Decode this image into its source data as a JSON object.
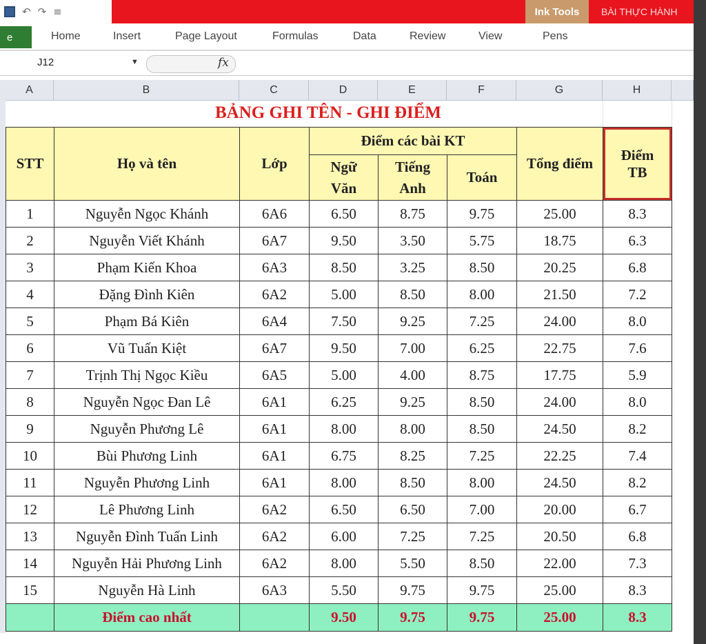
{
  "titlebar": {
    "ink_tools": "Ink Tools",
    "doc_title": "BÀI THỰC HÀNH"
  },
  "ribbon": {
    "file_tab": "e",
    "tabs": [
      "Home",
      "Insert",
      "Page Layout",
      "Formulas",
      "Data",
      "Review",
      "View",
      "Pens"
    ]
  },
  "formula_bar": {
    "name_box": "J12",
    "fx_label": "fx",
    "formula": ""
  },
  "columns": [
    "A",
    "B",
    "C",
    "D",
    "E",
    "F",
    "G",
    "H"
  ],
  "sheet": {
    "title": "BẢNG GHI TÊN - GHI ĐIỂM",
    "headers": {
      "stt": "STT",
      "name": "Họ và tên",
      "class": "Lớp",
      "scores_group": "Điểm các bài KT",
      "lit1": "Ngữ",
      "lit2": "Văn",
      "eng1": "Tiếng",
      "eng2": "Anh",
      "math": "Toán",
      "total": "Tổng điểm",
      "avg1": "Điểm",
      "avg2": "TB"
    },
    "rows": [
      [
        "1",
        "Nguyễn Ngọc Khánh",
        "6A6",
        "6.50",
        "8.75",
        "9.75",
        "25.00",
        "8.3"
      ],
      [
        "2",
        "Nguyễn Viết Khánh",
        "6A7",
        "9.50",
        "3.50",
        "5.75",
        "18.75",
        "6.3"
      ],
      [
        "3",
        "Phạm Kiến Khoa",
        "6A3",
        "8.50",
        "3.25",
        "8.50",
        "20.25",
        "6.8"
      ],
      [
        "4",
        "Đặng Đình Kiên",
        "6A2",
        "5.00",
        "8.50",
        "8.00",
        "21.50",
        "7.2"
      ],
      [
        "5",
        "Phạm Bá Kiên",
        "6A4",
        "7.50",
        "9.25",
        "7.25",
        "24.00",
        "8.0"
      ],
      [
        "6",
        "Vũ Tuấn Kiệt",
        "6A7",
        "9.50",
        "7.00",
        "6.25",
        "22.75",
        "7.6"
      ],
      [
        "7",
        "Trịnh Thị Ngọc Kiều",
        "6A5",
        "5.00",
        "4.00",
        "8.75",
        "17.75",
        "5.9"
      ],
      [
        "8",
        "Nguyễn Ngọc Đan Lê",
        "6A1",
        "6.25",
        "9.25",
        "8.50",
        "24.00",
        "8.0"
      ],
      [
        "9",
        "Nguyễn Phương Lê",
        "6A1",
        "8.00",
        "8.00",
        "8.50",
        "24.50",
        "8.2"
      ],
      [
        "10",
        "Bùi Phương Linh",
        "6A1",
        "6.75",
        "8.25",
        "7.25",
        "22.25",
        "7.4"
      ],
      [
        "11",
        "Nguyễn Phương Linh",
        "6A1",
        "8.00",
        "8.50",
        "8.00",
        "24.50",
        "8.2"
      ],
      [
        "12",
        "Lê Phương Linh",
        "6A2",
        "6.50",
        "6.50",
        "7.00",
        "20.00",
        "6.7"
      ],
      [
        "13",
        "Nguyễn Đình Tuấn Linh",
        "6A2",
        "6.00",
        "7.25",
        "7.25",
        "20.50",
        "6.8"
      ],
      [
        "14",
        "Nguyễn Hải Phương Linh",
        "6A2",
        "8.00",
        "5.50",
        "8.50",
        "22.00",
        "7.3"
      ],
      [
        "15",
        "Nguyễn Hà Linh",
        "6A3",
        "5.50",
        "9.75",
        "9.75",
        "25.00",
        "8.3"
      ]
    ],
    "max_row": {
      "label": "Điểm cao nhất",
      "lit": "9.50",
      "eng": "9.75",
      "math": "9.75",
      "total": "25.00",
      "avg": "8.3"
    }
  },
  "colors": {
    "title_red": "#e8141e",
    "header_fill": "#fff8b3",
    "max_row_fill": "#8ef0c0",
    "accent_text": "#d9201e"
  }
}
